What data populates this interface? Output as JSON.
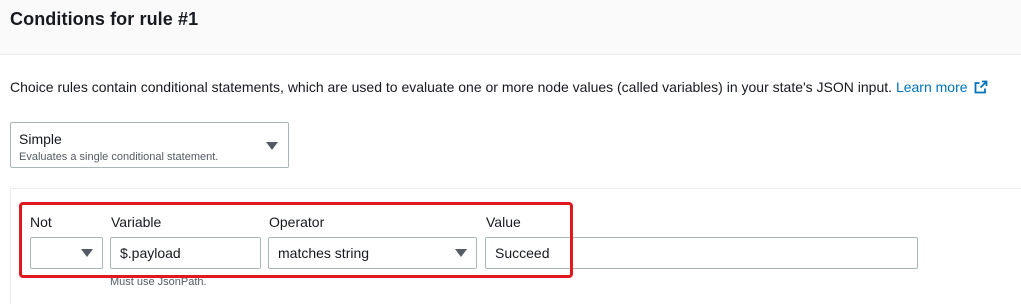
{
  "header": {
    "title": "Conditions for rule #1"
  },
  "description": {
    "text": "Choice rules contain conditional statements, which are used to evaluate one or more node values (called variables) in your state's JSON input.",
    "link_label": "Learn more",
    "link_icon": "external-link-icon"
  },
  "rule_type": {
    "selected": "Simple",
    "subtitle": "Evaluates a single conditional statement."
  },
  "condition": {
    "labels": {
      "not": "Not",
      "variable": "Variable",
      "operator": "Operator",
      "value": "Value"
    },
    "not_value": "",
    "variable_value": "$.payload",
    "variable_hint": "Must use JsonPath.",
    "operator_value": "matches string",
    "value_value": "Succeed"
  },
  "colors": {
    "highlight": "#e0191e",
    "link": "#0073bb"
  }
}
